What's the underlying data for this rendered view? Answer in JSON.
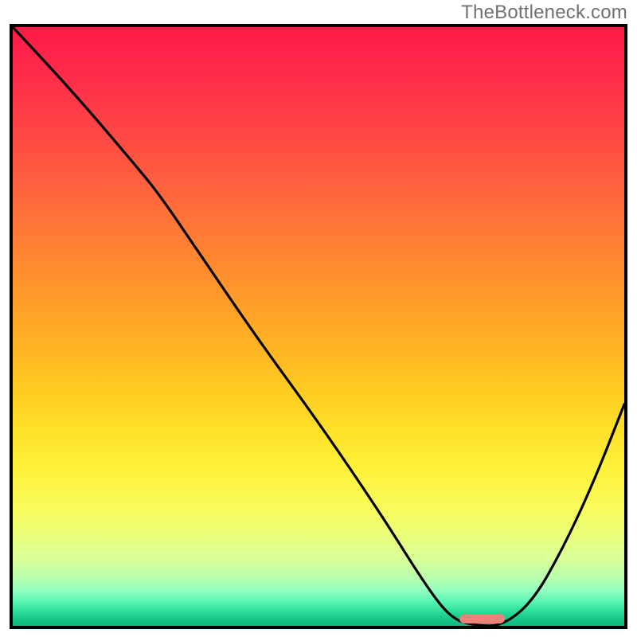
{
  "watermark": "TheBottleneck.com",
  "chart_data": {
    "type": "line",
    "title": "",
    "xlabel": "",
    "ylabel": "",
    "xlim": [
      0,
      100
    ],
    "ylim": [
      0,
      100
    ],
    "grid": false,
    "legend": false,
    "series": [
      {
        "name": "bottleneck-curve",
        "x": [
          0,
          10,
          20,
          24,
          30,
          40,
          50,
          60,
          68,
          72,
          76,
          80,
          85,
          90,
          95,
          100
        ],
        "y": [
          100,
          89,
          77,
          72,
          63,
          48,
          34,
          19,
          6,
          1,
          0,
          0,
          4,
          13,
          24,
          37
        ]
      }
    ],
    "annotations": [
      {
        "name": "optimal-marker",
        "type": "pill",
        "x_range": [
          73,
          80.5
        ],
        "y": 1.2,
        "color": "#f0807a"
      }
    ],
    "background": {
      "type": "vertical-gradient",
      "stops": [
        {
          "pos": 0,
          "color": "#ff1a47"
        },
        {
          "pos": 0.5,
          "color": "#ffa327"
        },
        {
          "pos": 0.8,
          "color": "#f8fb58"
        },
        {
          "pos": 0.96,
          "color": "#58f5b2"
        },
        {
          "pos": 1.0,
          "color": "#11b97f"
        }
      ]
    }
  },
  "plot": {
    "inner_w": 768,
    "inner_h": 752
  }
}
